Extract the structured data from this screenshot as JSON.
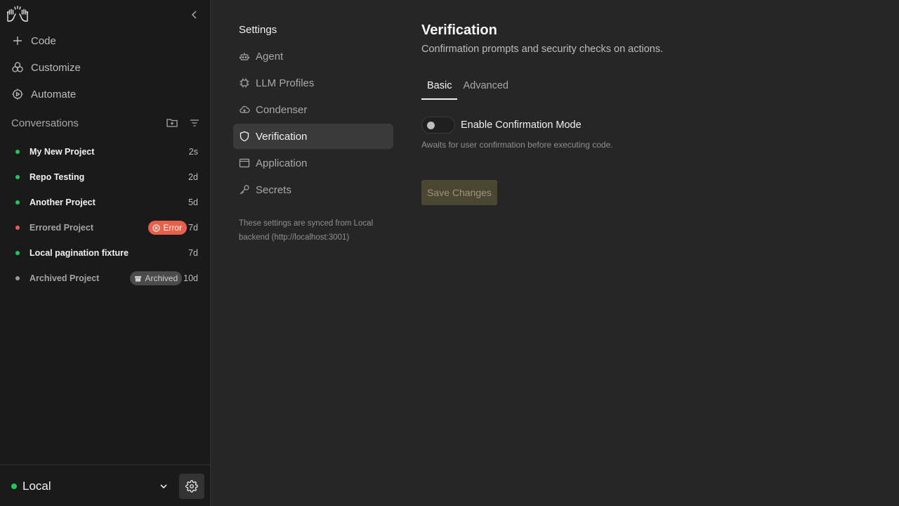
{
  "sidebar": {
    "nav": [
      {
        "label": "Code",
        "icon": "plus-icon"
      },
      {
        "label": "Customize",
        "icon": "customize-icon"
      },
      {
        "label": "Automate",
        "icon": "automate-icon"
      }
    ],
    "conversations_label": "Conversations",
    "conversations": [
      {
        "title": "My New Project",
        "time": "2s",
        "status": "green"
      },
      {
        "title": "Repo Testing",
        "time": "2d",
        "status": "green"
      },
      {
        "title": "Another Project",
        "time": "5d",
        "status": "green"
      },
      {
        "title": "Errored Project",
        "time": "7d",
        "status": "red",
        "badge": "Error"
      },
      {
        "title": "Local pagination fixture",
        "time": "7d",
        "status": "green"
      },
      {
        "title": "Archived Project",
        "time": "10d",
        "status": "gray",
        "badge": "Archived"
      }
    ],
    "backend_label": "Local"
  },
  "settings": {
    "title": "Settings",
    "nav": [
      {
        "label": "Agent",
        "icon": "robot-icon"
      },
      {
        "label": "LLM Profiles",
        "icon": "chip-icon"
      },
      {
        "label": "Condenser",
        "icon": "cloud-icon"
      },
      {
        "label": "Verification",
        "icon": "shield-icon",
        "active": true
      },
      {
        "label": "Application",
        "icon": "window-icon"
      },
      {
        "label": "Secrets",
        "icon": "key-icon"
      }
    ],
    "sync_note": "These settings are synced from Local backend (http://localhost:3001)"
  },
  "main": {
    "title": "Verification",
    "subtitle": "Confirmation prompts and security checks on actions.",
    "tabs": [
      {
        "label": "Basic",
        "active": true
      },
      {
        "label": "Advanced",
        "active": false
      }
    ],
    "confirmation_toggle_label": "Enable Confirmation Mode",
    "confirmation_toggle_on": false,
    "confirmation_help": "Awaits for user confirmation before executing code.",
    "save_label": "Save Changes"
  },
  "colors": {
    "status_green": "#22c55e",
    "status_red": "#e8604c",
    "status_gray": "#9a9a9a"
  }
}
